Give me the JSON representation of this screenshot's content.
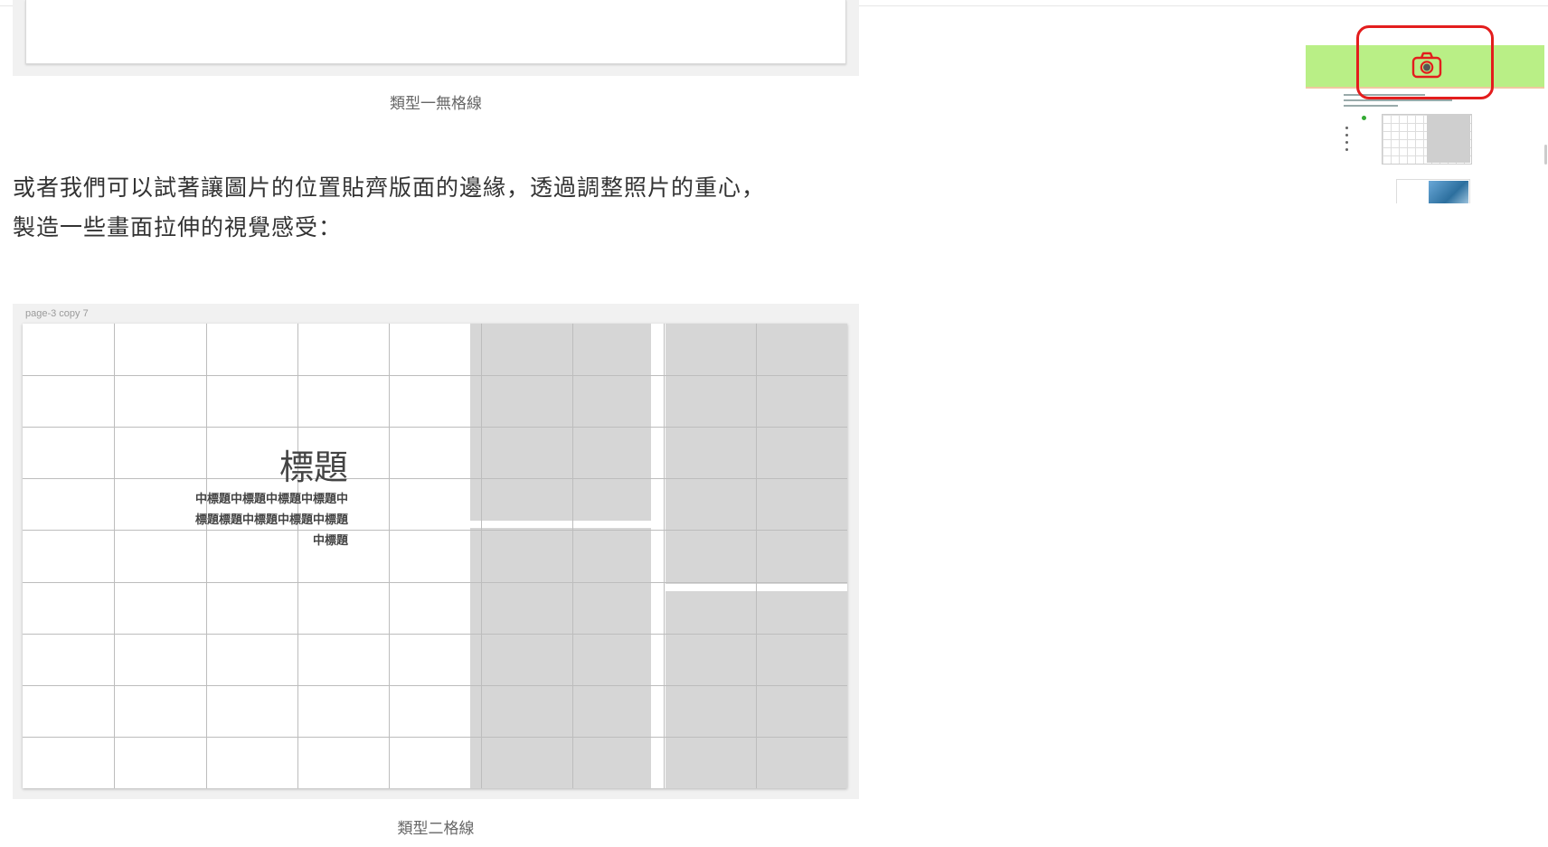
{
  "figure1": {
    "caption": "類型一無格線"
  },
  "paragraph": {
    "line1": "或者我們可以試著讓圖片的位置貼齊版面的邊緣，透過調整照片的重心，",
    "line2": "製造一些畫面拉伸的視覺感受："
  },
  "figure2": {
    "artboard_label": "page-3 copy 7",
    "heading": "標題",
    "subtitle_lines": [
      "中標題中標題中標題中標題中",
      "標題標題中標題中標題中標題",
      "中標題"
    ],
    "caption": "類型二格線"
  },
  "thumbnail": {
    "bar_color": "#b9ef86",
    "icon": "camera-icon",
    "highlight_color": "#e31d1d"
  }
}
